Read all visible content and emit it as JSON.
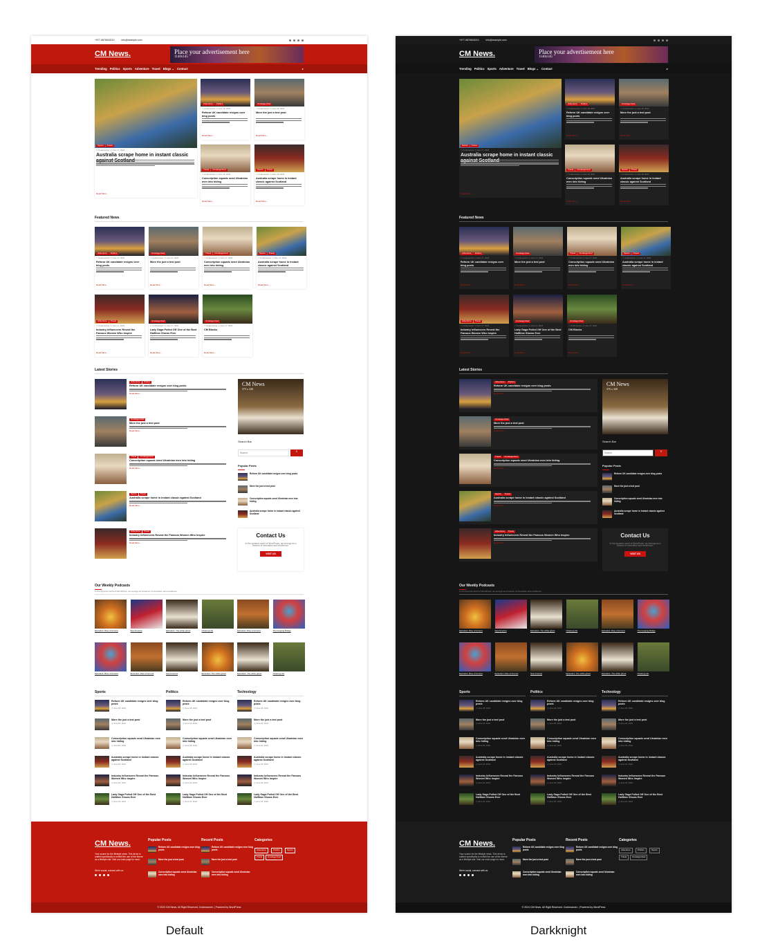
{
  "top": {
    "phone": "+977-9876543210",
    "email": "info@example.com"
  },
  "logo": "CM News.",
  "ad": {
    "title": "Place your advertisement here",
    "size": "1140x145"
  },
  "nav": [
    "Trending",
    "Politics",
    "Sports",
    "Adventure",
    "Travel",
    "Blogs ⌄",
    "Contact"
  ],
  "hero": {
    "tags": [
      "Sports",
      "Travel"
    ],
    "author": "Codemanner",
    "date": "June 17, 2024",
    "title": "Australia scrape home in instant classic against Scotland",
    "excerpt": "Lorem ipsum dolor sit amet, consectetur adipiscing elit. Suspendisse eleifend felis vitae scelerisque tempor. Vestibulum...",
    "read_more": "Read More..."
  },
  "side_posts": [
    {
      "tags": [
        "Adventure",
        "Politics"
      ],
      "title": "Reform UK candidate resigns over blog posts"
    },
    {
      "tags": [
        "Uncategorized"
      ],
      "title": "More the just a test post"
    },
    {
      "tags": [
        "Travel",
        "Uncategorized"
      ],
      "title": "Conscription squads send Ukrainian men into hiding"
    },
    {
      "tags": [
        "Sports",
        "Travel"
      ],
      "title": "Australia scrape home in instant classic against Scotland"
    }
  ],
  "featured": {
    "heading": "Featured News",
    "items": [
      {
        "tags": [
          "Adventure",
          "Politics"
        ],
        "title": "Reform UK candidate resigns over blog posts"
      },
      {
        "tags": [
          "Uncategorized"
        ],
        "title": "More the just a test post"
      },
      {
        "tags": [
          "Travel",
          "Uncategorized"
        ],
        "title": "Conscription squads send Ukrainian men into hiding"
      },
      {
        "tags": [
          "Sports",
          "Travel"
        ],
        "title": "Australia scrape home in instant classic against Scotland"
      },
      {
        "tags": [
          "Adventure",
          "Travel"
        ],
        "title": "Industry Influencers Reveal the Famous Women Who Inspire"
      },
      {
        "tags": [
          "Uncategorized"
        ],
        "title": "Lady Gaga Pulled Off One of the Best Halftime Shows Ever"
      },
      {
        "tags": [
          "Uncategorized"
        ],
        "title": "CM Blocks"
      }
    ]
  },
  "latest": {
    "heading": "Latest Stories",
    "items": [
      {
        "tags": [
          "Adventure",
          "Politics"
        ],
        "title": "Reform UK candidate resigns over blog posts"
      },
      {
        "tags": [
          "Uncategorized"
        ],
        "title": "More the just a test post"
      },
      {
        "tags": [
          "Travel",
          "Uncategorized"
        ],
        "title": "Conscription squads send Ukrainian men into hiding"
      },
      {
        "tags": [
          "Sports",
          "Travel"
        ],
        "title": "Australia scrape home in instant classic against Scotland"
      },
      {
        "tags": [
          "Adventure",
          "Travel"
        ],
        "title": "Industry Influencers Reveal the Famous Women Who Inspire"
      }
    ]
  },
  "sidebar": {
    "ad_title": "CM News",
    "ad_size": "375 x 320",
    "search_label": "Search Bar",
    "search_placeholder": "Search",
    "popular_label": "Popular Posts",
    "popular": [
      "Reform UK candidate resigns over blog posts",
      "More the just a test post",
      "Conscription squads send Ukrainian men into hiding",
      "Australia scrape home in instant classic against Scotland"
    ],
    "contact_title": "Contact Us",
    "contact_text": "In the dynamic world of WordPress, we emerge as a beacon of innovation and excellence.",
    "contact_btn": "VISIT US"
  },
  "podcasts": {
    "heading": "Our Weekly Podcasts",
    "sub": "In the dynamic world of WordPress, we emerge as a beacon of innovation and excellence.",
    "row1": [
      "Episode1: Rise of Annora",
      "Sea America",
      "Episode1: The white ghost",
      "Chasing Life",
      "Episode1: Rise of Annora",
      "The hanging Bridge"
    ],
    "row2": [
      "Episode1: Rise of Annora",
      "Episode1: Rise of Annora",
      "Sea America",
      "Episode1: The white ghost",
      "Episode1: The white ghost",
      "Chasing Life"
    ]
  },
  "categories": {
    "cols": [
      "Sports",
      "Politics",
      "Technology"
    ],
    "items": [
      "Reform UK candidate resigns over blog posts",
      "More the just a test post",
      "Conscription squads send Ukrainian men into hiding",
      "Australia scrape home in instant classic against Scotland",
      "Industry Influencers Reveal the Famous Women Who Inspire",
      "Lady Gaga Pulled Off One of the Best Halftime Shows Ever"
    ]
  },
  "footer": {
    "logo": "CM News.",
    "about": "Your source for the lifestyle news. This demo is crafted specifically to exhibit the use of the theme as a lifestyle site. Visit our main page for more.",
    "social_label": "We're social, connect with us:",
    "popular_label": "Popular Posts",
    "recent_label": "Recent Posts",
    "categories_label": "Categories",
    "posts": [
      "Reform UK candidate resigns over blog posts",
      "More the just a test post",
      "Conscription squads send Ukrainian men into hiding"
    ],
    "cats": [
      "Adventure",
      "Politics",
      "Sports",
      "Travel",
      "Uncategorized"
    ],
    "copyright": "© 2024 CM News. All Right Reserved. Codemanner. | Powered by WordPress"
  },
  "captions": {
    "default": "Default",
    "dark": "Darkknight"
  },
  "colors": {
    "accent": "#c0180c",
    "dark_bg": "#161616",
    "dark_card": "#202020"
  }
}
